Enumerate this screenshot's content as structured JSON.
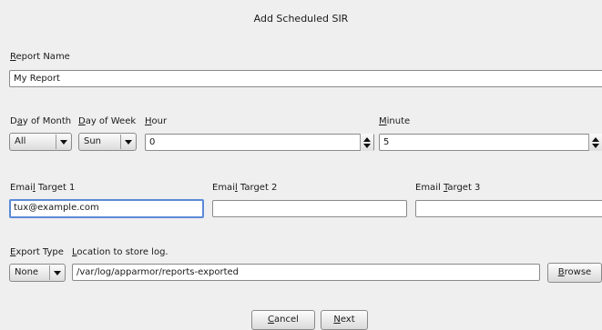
{
  "dialog": {
    "title": "Add Scheduled SIR"
  },
  "report_name": {
    "label": "Report Name",
    "value": "My Report"
  },
  "schedule": {
    "day_of_month": {
      "label": "Day of Month",
      "value": "All"
    },
    "day_of_week": {
      "label": "Day of Week",
      "value": "Sun"
    },
    "hour": {
      "label": "Hour",
      "value": "0"
    },
    "minute": {
      "label": "Minute",
      "value": "5"
    }
  },
  "email": {
    "target1": {
      "label": "Email Target 1",
      "value": "tux@example.com"
    },
    "target2": {
      "label": "Email Target 2",
      "value": ""
    },
    "target3": {
      "label": "Email Target 3",
      "value": ""
    }
  },
  "export": {
    "type_label": "Export Type",
    "type_value": "None",
    "location_label": "Location to store log.",
    "location_value": "/var/log/apparmor/reports-exported",
    "browse_label": "Browse"
  },
  "actions": {
    "cancel_label": "Cancel",
    "next_label": "Next"
  },
  "colors": {
    "background": "#efefef",
    "focus": "#5b8ad8"
  }
}
